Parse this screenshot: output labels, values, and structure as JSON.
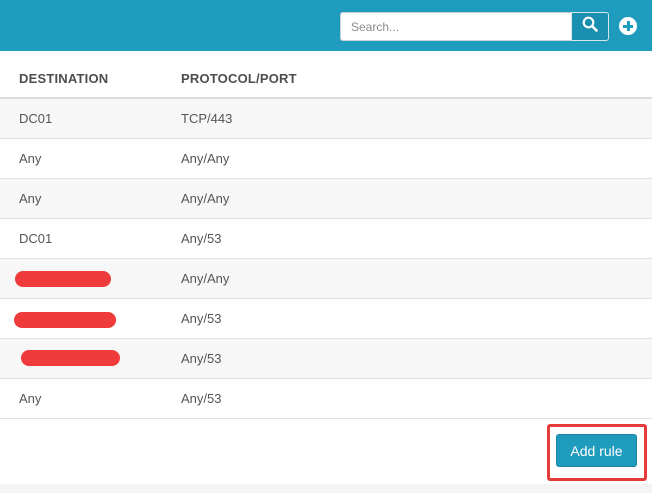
{
  "toolbar": {
    "search_placeholder": "Search...",
    "search_icon": "search-icon",
    "add_icon": "plus-circle-icon"
  },
  "table": {
    "headers": [
      "DESTINATION",
      "PROTOCOL/PORT"
    ],
    "rows": [
      {
        "destination": "DC01",
        "protocol_port": "TCP/443"
      },
      {
        "destination": "Any",
        "protocol_port": "Any/Any"
      },
      {
        "destination": "Any",
        "protocol_port": "Any/Any"
      },
      {
        "destination": "DC01",
        "protocol_port": "Any/53"
      },
      {
        "destination": "",
        "protocol_port": "Any/Any",
        "redacted": true
      },
      {
        "destination": "",
        "protocol_port": "Any/53",
        "redacted": true
      },
      {
        "destination": "",
        "protocol_port": "Any/53",
        "redacted": true
      },
      {
        "destination": "Any",
        "protocol_port": "Any/53"
      }
    ]
  },
  "actions": {
    "add_rule_label": "Add rule"
  },
  "colors": {
    "accent": "#1f9bbd",
    "redaction": "#ef3b3b",
    "highlight": "#e63b3b"
  }
}
